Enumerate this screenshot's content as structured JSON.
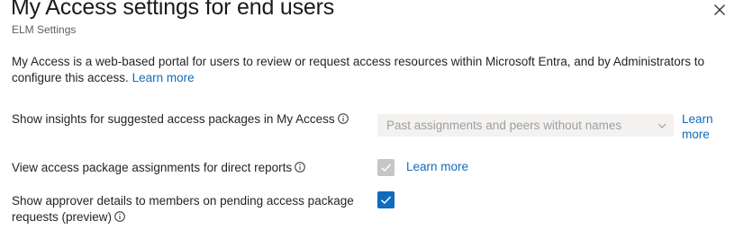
{
  "header": {
    "title": "My Access settings for end users",
    "subtitle": "ELM Settings"
  },
  "description": {
    "text": "My Access is a web-based portal for users to review or request access resources within Microsoft Entra, and by Administrators to configure this access.",
    "learn_more": "Learn more"
  },
  "settings": {
    "insights": {
      "label": "Show insights for suggested access packages in My Access",
      "dropdown_value": "Past assignments and peers without names",
      "learn_more": "Learn more"
    },
    "direct_reports": {
      "label": "View access package assignments for direct reports",
      "checked": true,
      "disabled": true,
      "learn_more": "Learn more"
    },
    "approver_details": {
      "label": "Show approver details to members on pending access package requests (preview)",
      "checked": true,
      "disabled": false
    }
  },
  "icons": {
    "close": "close-icon",
    "info": "info-icon",
    "chevron": "chevron-down-icon",
    "check": "checkmark-icon"
  },
  "colors": {
    "link": "#0f6cbd",
    "checkbox_checked": "#0f6cbd",
    "checkbox_disabled": "#c8c6c4",
    "dropdown_disabled_bg": "#f3f2f1"
  }
}
